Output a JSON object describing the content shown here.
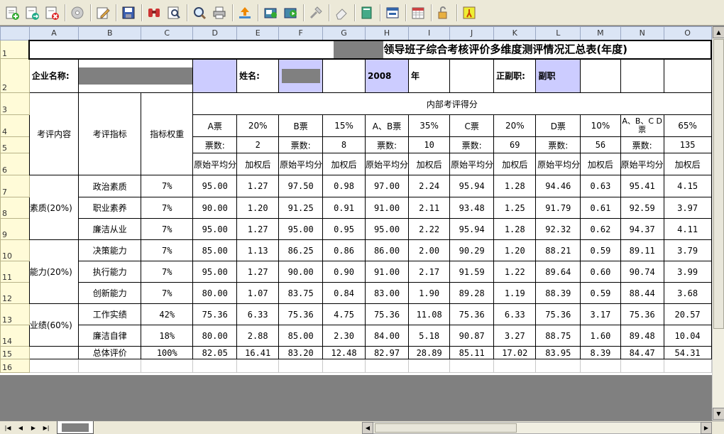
{
  "toolbar": {
    "icons": [
      "add-sheet-icon",
      "import-icon",
      "delete-sheet-icon",
      "disc-icon",
      "edit-icon",
      "save-icon",
      "find-icon",
      "preview-icon",
      "zoom-icon",
      "print-icon",
      "upload-icon",
      "export-icon",
      "export-play-icon",
      "tools-icon",
      "erase-icon",
      "book-icon",
      "window-icon",
      "calendar-icon",
      "lock-icon",
      "run-icon"
    ]
  },
  "columns": [
    "A",
    "B",
    "C",
    "D",
    "E",
    "F",
    "G",
    "H",
    "I",
    "J",
    "K",
    "L",
    "M",
    "N",
    "O"
  ],
  "rows": [
    "1",
    "2",
    "3",
    "4",
    "5",
    "6",
    "7",
    "8",
    "9",
    "10",
    "11",
    "12",
    "13",
    "14",
    "15",
    "16"
  ],
  "sheet": {
    "title": "领导班子综合考核评价多维度测评情况汇总表(年度)",
    "company_label": "企业名称:",
    "name_label": "姓名:",
    "year": "2008",
    "year_suffix": "年",
    "position_label": "正副职:",
    "position_value": "副职",
    "internal_score_header": "内部考评得分",
    "eval_content": "考评内容",
    "eval_indicator": "考评指标",
    "indicator_weight": "指标权重",
    "vote_groups": [
      {
        "name": "A票",
        "weight": "20%",
        "count_label": "票数:",
        "count": "2"
      },
      {
        "name": "B票",
        "weight": "15%",
        "count_label": "票数:",
        "count": "8"
      },
      {
        "name": "A、B票",
        "weight": "35%",
        "count_label": "票数:",
        "count": "10"
      },
      {
        "name": "C票",
        "weight": "20%",
        "count_label": "票数:",
        "count": "69"
      },
      {
        "name": "D票",
        "weight": "10%",
        "count_label": "票数:",
        "count": "56"
      },
      {
        "name": "A、B、C D票",
        "weight": "65%",
        "count_label": "票数:",
        "count": "135"
      }
    ],
    "raw_avg_label": "原始平均分",
    "raw_avg_label_cut": "始平均分",
    "weighted_label": "加权后",
    "categories": [
      {
        "label": "素质(20%)",
        "items": [
          {
            "indicator": "政治素质",
            "weight": "7%",
            "values": [
              "95.00",
              "1.27",
              "97.50",
              "0.98",
              "97.00",
              "2.24",
              "95.94",
              "1.28",
              "94.46",
              "0.63",
              "95.41",
              "4.15"
            ]
          },
          {
            "indicator": "职业素养",
            "weight": "7%",
            "values": [
              "90.00",
              "1.20",
              "91.25",
              "0.91",
              "91.00",
              "2.11",
              "93.48",
              "1.25",
              "91.79",
              "0.61",
              "92.59",
              "3.97"
            ]
          },
          {
            "indicator": "廉洁从业",
            "weight": "7%",
            "values": [
              "95.00",
              "1.27",
              "95.00",
              "0.95",
              "95.00",
              "2.22",
              "95.94",
              "1.28",
              "92.32",
              "0.62",
              "94.37",
              "4.11"
            ]
          }
        ]
      },
      {
        "label": "能力(20%)",
        "items": [
          {
            "indicator": "决策能力",
            "weight": "7%",
            "values": [
              "85.00",
              "1.13",
              "86.25",
              "0.86",
              "86.00",
              "2.00",
              "90.29",
              "1.20",
              "88.21",
              "0.59",
              "89.11",
              "3.79"
            ]
          },
          {
            "indicator": "执行能力",
            "weight": "7%",
            "values": [
              "95.00",
              "1.27",
              "90.00",
              "0.90",
              "91.00",
              "2.17",
              "91.59",
              "1.22",
              "89.64",
              "0.60",
              "90.74",
              "3.99"
            ]
          },
          {
            "indicator": "创新能力",
            "weight": "7%",
            "values": [
              "80.00",
              "1.07",
              "83.75",
              "0.84",
              "83.00",
              "1.90",
              "89.28",
              "1.19",
              "88.39",
              "0.59",
              "88.44",
              "3.68"
            ]
          }
        ]
      },
      {
        "label": "业绩(60%)",
        "items": [
          {
            "indicator": "工作实绩",
            "weight": "42%",
            "values": [
              "75.36",
              "6.33",
              "75.36",
              "4.75",
              "75.36",
              "11.08",
              "75.36",
              "6.33",
              "75.36",
              "3.17",
              "75.36",
              "20.57"
            ]
          },
          {
            "indicator": "廉洁自律",
            "weight": "18%",
            "values": [
              "80.00",
              "2.88",
              "85.00",
              "2.30",
              "84.00",
              "5.18",
              "90.87",
              "3.27",
              "88.75",
              "1.60",
              "89.48",
              "10.04"
            ]
          }
        ]
      }
    ],
    "total": {
      "indicator": "总体评价",
      "weight": "100%",
      "values": [
        "82.05",
        "16.41",
        "83.20",
        "12.48",
        "82.97",
        "28.89",
        "85.11",
        "17.02",
        "83.95",
        "8.39",
        "84.47",
        "54.31"
      ]
    }
  },
  "sheet_tabs": [
    ""
  ],
  "colors": {
    "highlight": "#ccccff",
    "header_bg": "#dbe5f5",
    "row_header_bg": "#fffbd8",
    "background": "#808080"
  }
}
